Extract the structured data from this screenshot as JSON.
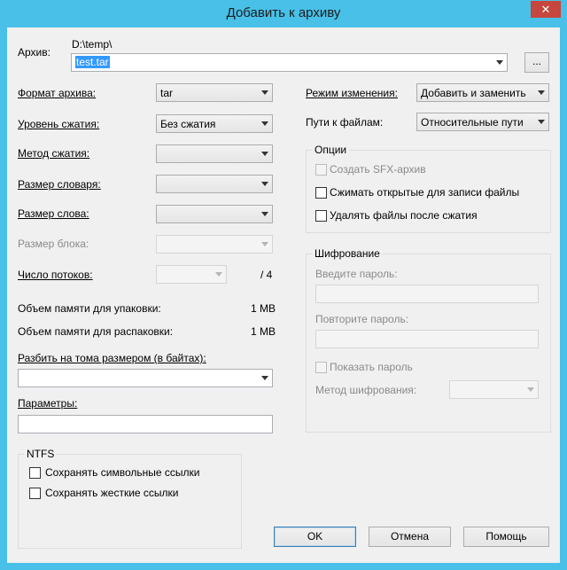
{
  "window": {
    "title": "Добавить к архиву",
    "close_glyph": "✕"
  },
  "archive": {
    "label": "Архив:",
    "path": "D:\\temp\\",
    "filename": "test.tar",
    "browse_label": "..."
  },
  "left": {
    "format": {
      "label": "Формат архива:",
      "value": "tar"
    },
    "level": {
      "label": "Уровень сжатия:",
      "value": "Без сжатия"
    },
    "method": {
      "label": "Метод сжатия:",
      "value": ""
    },
    "dict": {
      "label": "Размер словаря:",
      "value": ""
    },
    "word": {
      "label": "Размер слова:",
      "value": ""
    },
    "block": {
      "label": "Размер блока:",
      "value": ""
    },
    "threads": {
      "label": "Число потоков:",
      "value": "",
      "max": "/ 4"
    },
    "mem_pack": {
      "label": "Объем памяти для упаковки:",
      "value": "1 MB"
    },
    "mem_unpack": {
      "label": "Объем памяти для распаковки:",
      "value": "1 MB"
    },
    "split": {
      "label": "Разбить на тома размером (в байтах):",
      "value": ""
    },
    "params": {
      "label": "Параметры:",
      "value": ""
    }
  },
  "ntfs": {
    "title": "NTFS",
    "symlinks": {
      "label": "Сохранять символьные ссылки",
      "checked": false
    },
    "hardlinks": {
      "label": "Сохранять жесткие ссылки",
      "checked": false
    }
  },
  "right": {
    "update_mode": {
      "label": "Режим изменения:",
      "value": "Добавить и заменить"
    },
    "path_mode": {
      "label": "Пути к файлам:",
      "value": "Относительные пути"
    }
  },
  "options": {
    "title": "Опции",
    "sfx": {
      "label": "Создать SFX-архив",
      "checked": false,
      "enabled": false
    },
    "shared": {
      "label": "Сжимать открытые для записи файлы",
      "checked": false
    },
    "delete": {
      "label": "Удалять файлы после сжатия",
      "checked": false
    }
  },
  "encryption": {
    "title": "Шифрование",
    "password_label": "Введите пароль:",
    "repeat_label": "Повторите пароль:",
    "show_label": "Показать пароль",
    "method_label": "Метод шифрования:",
    "method_value": ""
  },
  "buttons": {
    "ok": "OK",
    "cancel": "Отмена",
    "help": "Помощь"
  }
}
